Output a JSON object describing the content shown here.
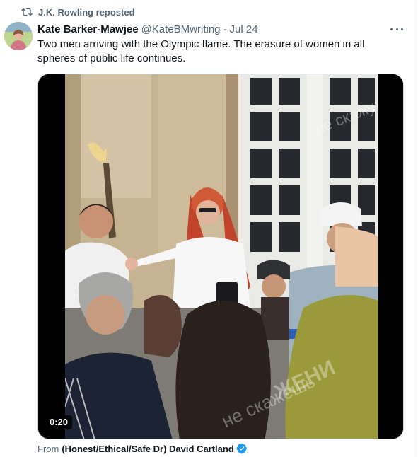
{
  "repost": {
    "icon": "repost-icon",
    "label": "J.K. Rowling reposted"
  },
  "author": {
    "avatar_icon": "avatar",
    "name": "Kate Barker-Mawjee",
    "handle": "@KateBMwriting",
    "separator": "·",
    "date": "Jul 24"
  },
  "tweet": {
    "text": "Two men arriving with the Olympic flame. The erasure of women in all spheres of public life continues."
  },
  "media": {
    "duration": "0:20",
    "watermark_top": "не скажу",
    "watermark_bottom_1": "ЖЕНИ",
    "watermark_bottom_2": "не скажешь"
  },
  "source": {
    "label": "From",
    "name": "(Honest/Ethical/Safe Dr) David Cartland",
    "verified_icon": "verified-badge-icon",
    "verified_color": "#1d9bf0"
  },
  "colors": {
    "text_primary": "#0f1419",
    "text_secondary": "#536471",
    "border": "#cfd9de"
  }
}
